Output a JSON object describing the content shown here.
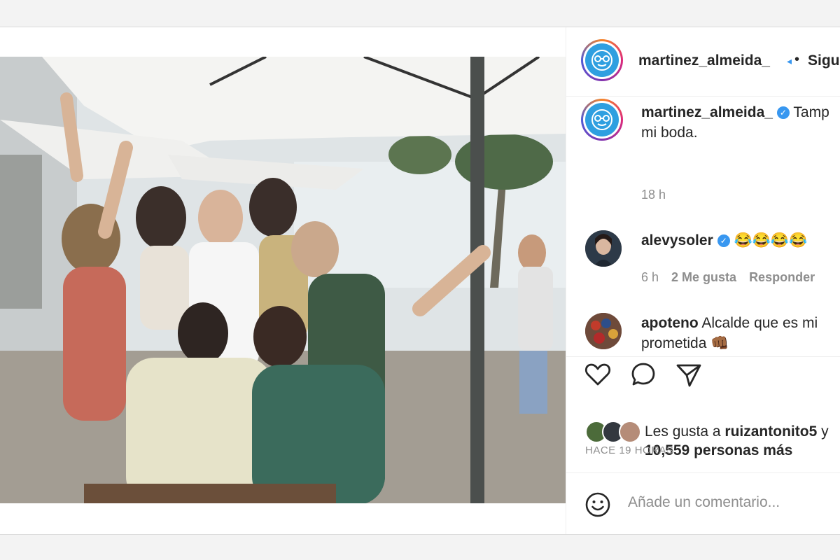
{
  "post": {
    "username": "martinez_almeida_",
    "dot": "•",
    "follow_label": "Sigu"
  },
  "caption": {
    "username": "martinez_almeida_",
    "text_line1": "Tamp",
    "text_line2": "mi boda.",
    "time": "18 h"
  },
  "comments": [
    {
      "username": "alevysoler",
      "text": "😂😂😂😂",
      "time": "6 h",
      "likes": "2 Me gusta",
      "reply": "Responder"
    },
    {
      "username": "apoteno",
      "text_line1": "Alcalde que es mi",
      "text_line2": "prometida 👊🏾"
    }
  ],
  "likes": {
    "prefix": "Les gusta a ",
    "user": "ruizantonito5",
    "suffix": " y",
    "others": "10,559 personas más"
  },
  "timestamp": "HACE 19 HORAS",
  "add_comment": {
    "placeholder": "Añade un comentario..."
  },
  "colors": {
    "accent_blue": "#3897f0",
    "text": "#262626",
    "muted": "#8e8e8e"
  }
}
